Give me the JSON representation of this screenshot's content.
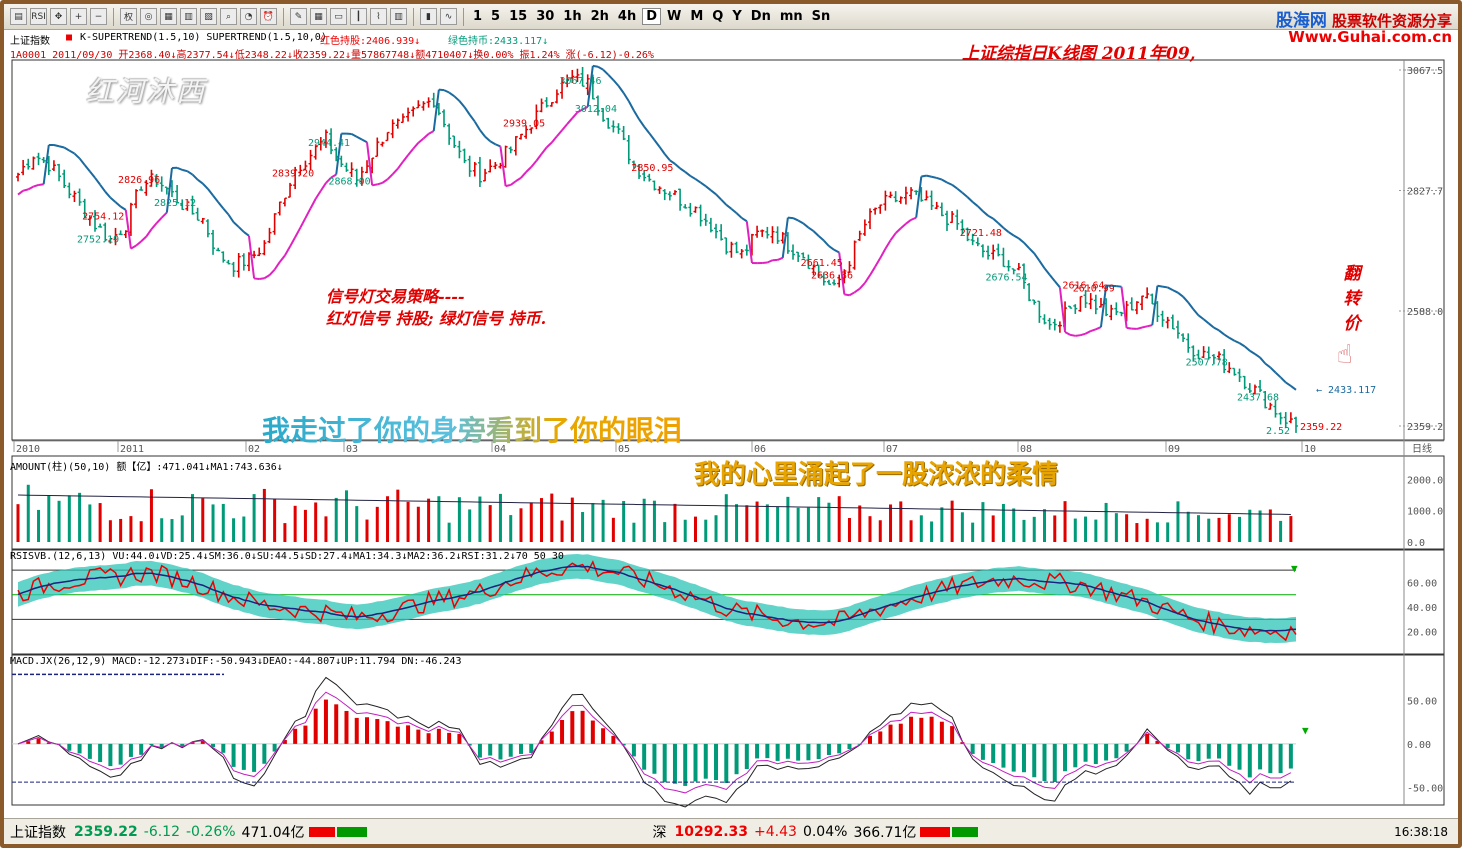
{
  "toolbar": {
    "icons": [
      "folder-icon",
      "rsi-icon",
      "move-icon",
      "zoom-in-icon",
      "zoom-out-icon",
      "weight-icon",
      "glasses-icon",
      "grid-icon",
      "book-icon",
      "notebook-icon",
      "search-doc-icon",
      "gauge-icon",
      "alarm-icon",
      "pen-icon",
      "table-icon",
      "window-icon",
      "kline-icon",
      "line-chart-icon",
      "stats-icon",
      "bar-icon",
      "zigzag-icon"
    ],
    "rsi_label": "RSI",
    "weight_label": "权",
    "periods": [
      "1",
      "5",
      "15",
      "30",
      "1h",
      "2h",
      "4h",
      "D",
      "W",
      "M",
      "Q",
      "Y",
      "Dn",
      "mn",
      "Sn"
    ],
    "active_period": "D"
  },
  "logo": {
    "brand": "股海网",
    "slogan": "股票软件资源分享",
    "url": "Www.Guhai.com.cn"
  },
  "main": {
    "index_name": "上证指数",
    "indicator_line": "K-SUPERTREND(1.5,10) SUPERTREND(1.5,10,0)",
    "red_hold": "红色持股:2406.939↓",
    "green_hold": "绿色持币:2433.117↓",
    "ohlc_line": "1A0001 2011/09/30 开2368.40↓高2377.54↓低2348.22↓收2359.22↓量57867748↓额4710407↓换0.00% 振1.24% 涨(-6.12)-0.26%",
    "overlay_title": "上证综指日K线图 2011年09,",
    "watermark": "红河沐西",
    "strategy_line1": "信号灯交易策略----",
    "strategy_line2": "红灯信号 持股; 绿灯信号 持币.",
    "lyric1": "我走过了你的身旁看到了你的眼泪",
    "lyric2": "我的心里涌起了一股浓浓的柔情",
    "reverse_label": "翻转价",
    "hand_icon": "pointing-hand-icon",
    "current_marker": "← 2433.117",
    "y_ticks": [
      "3067.5",
      "2827.7",
      "2588.0",
      "2359.2"
    ]
  },
  "xaxis": {
    "labels": [
      "2010",
      "2011",
      "02",
      "03",
      "04",
      "05",
      "06",
      "07",
      "08",
      "09",
      "10"
    ],
    "right_label": "日线"
  },
  "amount": {
    "header": "AMOUNT(柱)(50,10) 额【亿】:471.041↓MA1:743.636↓",
    "y_ticks": [
      "2000.0",
      "1000.0",
      "0.0"
    ]
  },
  "rsi": {
    "header": "RSISVB.(12,6,13) VU:44.0↓VD:25.4↓SM:36.0↓SU:44.5↓SD:27.4↓MA1:34.3↓MA2:36.2↓RSI:31.2↓70 50 30",
    "y_ticks": [
      "60.00",
      "40.00",
      "20.00"
    ]
  },
  "macd": {
    "header": "MACD.JX(26,12,9) MACD:-12.273↓DIF:-50.943↓DEAO:-44.807↓UP:11.794 DN:-46.243",
    "y_ticks": [
      "50.00",
      "0.00",
      "-50.00"
    ]
  },
  "status": {
    "sh_name": "上证指数",
    "sh_value": "2359.22",
    "sh_change": "-6.12",
    "sh_pct": "-0.26%",
    "sh_amount": "471.04亿",
    "sz_name": "深",
    "sz_value": "10292.33",
    "sz_change": "+4.43",
    "sz_pct": "0.04%",
    "sz_amount": "366.71亿",
    "time": "16:38:18"
  },
  "colors": {
    "up": "#e00000",
    "down": "#009a78",
    "supertrend_red": "#e020c0",
    "supertrend_green": "#1a6aa0",
    "background": "#ffffff"
  },
  "chart_data": {
    "type": "candlestick",
    "title": "上证综指日K线图",
    "period": "daily",
    "x_range": [
      "2010-12",
      "2011-09-30"
    ],
    "ylim": [
      2359.2,
      3067.5
    ],
    "annotated_highs_lows": [
      {
        "label": "2939.05",
        "value": 2939.05
      },
      {
        "label": "2.52",
        "value": 2.52
      },
      {
        "label": "2721.48",
        "value": 2721.48
      },
      {
        "label": "2868.00",
        "value": 2868.0
      },
      {
        "label": "2661.45",
        "value": 2661.45
      },
      {
        "label": "2944.41",
        "value": 2944.41
      },
      {
        "label": "2839.20",
        "value": 2839.2
      },
      {
        "label": "3012.04",
        "value": 3012.04
      },
      {
        "label": "2850.95",
        "value": 2850.95
      },
      {
        "label": "3067.46",
        "value": 3067.46
      },
      {
        "label": "2754.12",
        "value": 2754.12
      },
      {
        "label": "2676.54",
        "value": 2676.54
      },
      {
        "label": "2610.99",
        "value": 2610.99
      },
      {
        "label": "2825.12",
        "value": 2825.12
      },
      {
        "label": "2826.96",
        "value": 2826.96
      },
      {
        "label": "2752.19",
        "value": 2752.19
      },
      {
        "label": "2636.36",
        "value": 2636.36
      },
      {
        "label": "2437.68",
        "value": 2437.68
      },
      {
        "label": "2616.64",
        "value": 2616.64
      },
      {
        "label": "2507.78",
        "value": 2507.78
      }
    ],
    "last_close": 2359.22,
    "supertrend_value": 2433.117,
    "price_path": [
      2860,
      2900,
      2880,
      2840,
      2800,
      2760,
      2730,
      2760,
      2840,
      2850,
      2820,
      2790,
      2770,
      2700,
      2680,
      2690,
      2720,
      2800,
      2870,
      2900,
      2930,
      2880,
      2850,
      2900,
      2950,
      2960,
      2990,
      3010,
      2940,
      2880,
      2860,
      2880,
      2910,
      2950,
      2990,
      3030,
      3050,
      3040,
      2980,
      2940,
      2880,
      2850,
      2830,
      2810,
      2790,
      2760,
      2720,
      2700,
      2740,
      2750,
      2720,
      2700,
      2660,
      2630,
      2690,
      2760,
      2800,
      2810,
      2820,
      2800,
      2780,
      2760,
      2720,
      2700,
      2690,
      2660,
      2600,
      2560,
      2580,
      2620,
      2600,
      2580,
      2590,
      2620,
      2590,
      2560,
      2520,
      2500,
      2490,
      2470,
      2440,
      2410,
      2380,
      2359
    ],
    "amount_ylim": [
      0,
      2300
    ],
    "rsi_levels": [
      70,
      50,
      30
    ],
    "macd_ylim": [
      -60,
      85
    ]
  }
}
